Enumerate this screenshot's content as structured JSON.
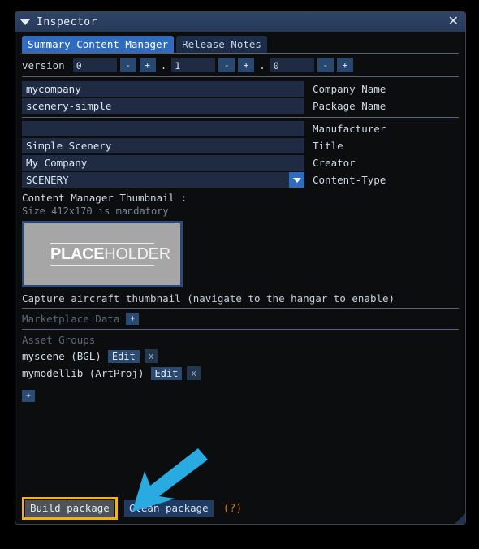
{
  "window": {
    "title": "Inspector",
    "collapse_icon": "triangle-down-icon",
    "close_icon": "close-icon"
  },
  "tabs": [
    {
      "label": "Summary Content Manager",
      "selected": true
    },
    {
      "label": "Release Notes",
      "selected": false
    }
  ],
  "version": {
    "label": "version",
    "major": "0",
    "minor": "1",
    "patch": "0",
    "minus_label": "-",
    "plus_label": "+"
  },
  "fields": [
    {
      "value": "mycompany",
      "label": "Company Name",
      "type": "text"
    },
    {
      "value": "scenery-simple",
      "label": "Package Name",
      "type": "text"
    },
    {
      "value": "",
      "label": "Manufacturer",
      "type": "text"
    },
    {
      "value": "Simple Scenery",
      "label": "Title",
      "type": "text"
    },
    {
      "value": "My Company",
      "label": "Creator",
      "type": "text"
    },
    {
      "value": "SCENERY",
      "label": "Content-Type",
      "type": "dropdown"
    }
  ],
  "thumbnail": {
    "caption": "Content Manager Thumbnail :",
    "size_note": "Size 412x170 is mandatory",
    "placeholder_bold": "PLACE",
    "placeholder_light": "HOLDER",
    "capture_note": "Capture aircraft thumbnail (navigate to the hangar to enable)"
  },
  "marketplace": {
    "label": "Marketplace Data",
    "add_label": "+"
  },
  "asset_groups": {
    "title": "Asset Groups",
    "add_label": "+",
    "items": [
      {
        "name": "myscene (BGL)",
        "edit_label": "Edit",
        "remove_label": "x"
      },
      {
        "name": "mymodellib (ArtProj)",
        "edit_label": "Edit",
        "remove_label": "x"
      }
    ]
  },
  "footer": {
    "build_label": "Build package",
    "clean_label": "Clean package",
    "help_label": "(?)"
  },
  "annotation": {
    "arrow_color": "#29abe2",
    "highlight_color": "#f5b400"
  }
}
